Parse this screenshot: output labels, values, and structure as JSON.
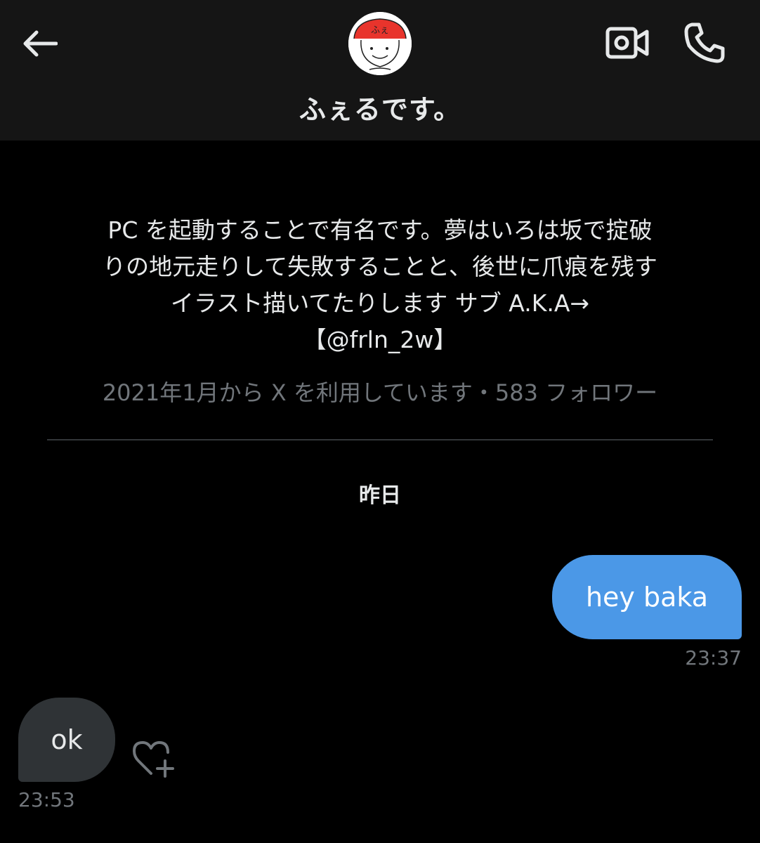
{
  "header": {
    "back_icon": "arrow-left-icon",
    "video_icon": "video-camera-icon",
    "call_icon": "phone-icon",
    "avatar_text": "ふぇ",
    "contact_name": "ふぇるです。"
  },
  "profile": {
    "bio_lines": [
      "PC を起動することで有名です。夢はいろは坂で掟破",
      "りの地元走りして失敗することと、後世に爪痕を残す",
      "イラスト描いてたりします サブ A.K.A→",
      "【@frln_2w】"
    ],
    "meta": "2021年1月から X を利用しています・583 フォロワー"
  },
  "conversation": {
    "date_label": "昨日",
    "messages": [
      {
        "direction": "sent",
        "text": "hey baka",
        "time": "23:37"
      },
      {
        "direction": "received",
        "text": "ok",
        "time": "23:53"
      }
    ],
    "react_icon": "heart-plus-icon"
  },
  "colors": {
    "background": "#000000",
    "header": "#151515",
    "sent_bubble": "#4b98e7",
    "received_bubble": "#2f3336",
    "secondary_text": "#71767b",
    "primary_text": "#e7e9ea"
  }
}
